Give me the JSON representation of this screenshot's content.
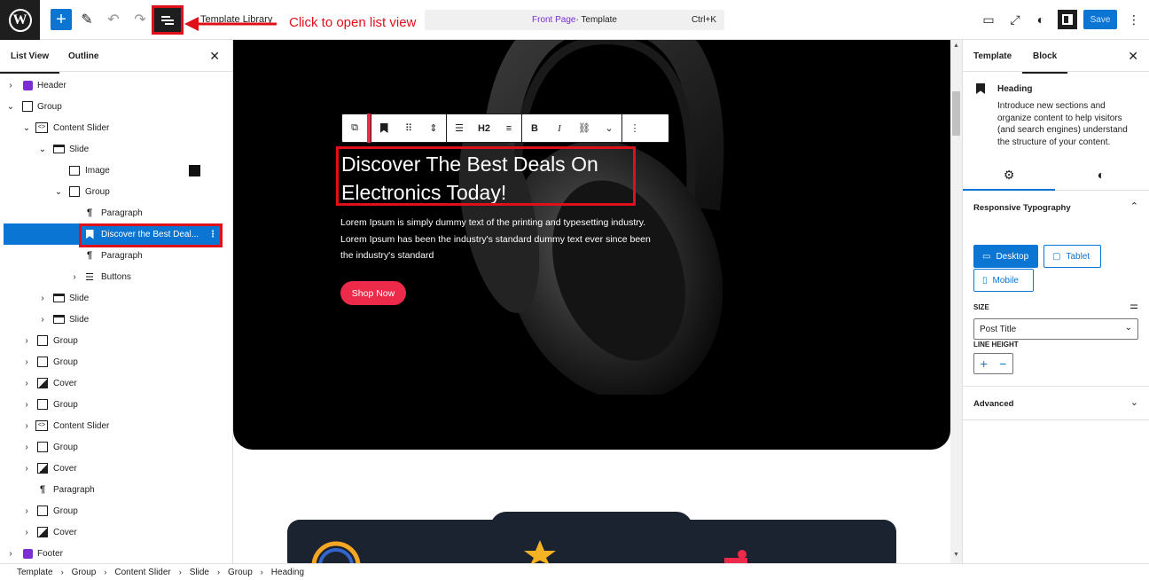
{
  "topbar": {
    "template_library": "Template Library",
    "annotation": "Click  to open list view",
    "doc_title_link": "Front Page",
    "doc_title_rest": " · Template",
    "shortcut": "Ctrl+K",
    "save": "Save"
  },
  "list_view": {
    "tab_list": "List View",
    "tab_outline": "Outline",
    "items": [
      {
        "label": "Header"
      },
      {
        "label": "Group"
      },
      {
        "label": "Content Slider"
      },
      {
        "label": "Slide"
      },
      {
        "label": "Image"
      },
      {
        "label": "Group"
      },
      {
        "label": "Paragraph"
      },
      {
        "label": "Discover the Best Deal..."
      },
      {
        "label": "Paragraph"
      },
      {
        "label": "Buttons"
      },
      {
        "label": "Slide"
      },
      {
        "label": "Slide"
      },
      {
        "label": "Group"
      },
      {
        "label": "Group"
      },
      {
        "label": "Cover"
      },
      {
        "label": "Group"
      },
      {
        "label": "Content Slider"
      },
      {
        "label": "Group"
      },
      {
        "label": "Cover"
      },
      {
        "label": "Paragraph"
      },
      {
        "label": "Group"
      },
      {
        "label": "Cover"
      },
      {
        "label": "Footer"
      }
    ]
  },
  "canvas": {
    "heading": "Discover The Best Deals On Electronics Today!",
    "description": "Lorem Ipsum is simply dummy text of the printing and typesetting industry. Lorem Ipsum has been the industry's standard dummy text ever since been the industry's standard",
    "button": "Shop Now",
    "toolbar_heading_level": "H2"
  },
  "sidebar": {
    "tab_template": "Template",
    "tab_block": "Block",
    "block_name": "Heading",
    "block_desc": "Introduce new sections and organize content to help visitors (and search engines) understand the structure of your content.",
    "responsive_typography": "Responsive Typography",
    "desktop": "Desktop",
    "tablet": "Tablet",
    "mobile": "Mobile",
    "size_label": "SIZE",
    "size_value": "Post Title",
    "line_height_label": "LINE HEIGHT",
    "advanced": "Advanced"
  },
  "breadcrumb": [
    "Template",
    "Group",
    "Content Slider",
    "Slide",
    "Group",
    "Heading"
  ],
  "colors": {
    "accent": "#0a75d3",
    "annotation": "#e0101a",
    "shop_button": "#ee2a4a",
    "hero_bg": "#000000"
  }
}
